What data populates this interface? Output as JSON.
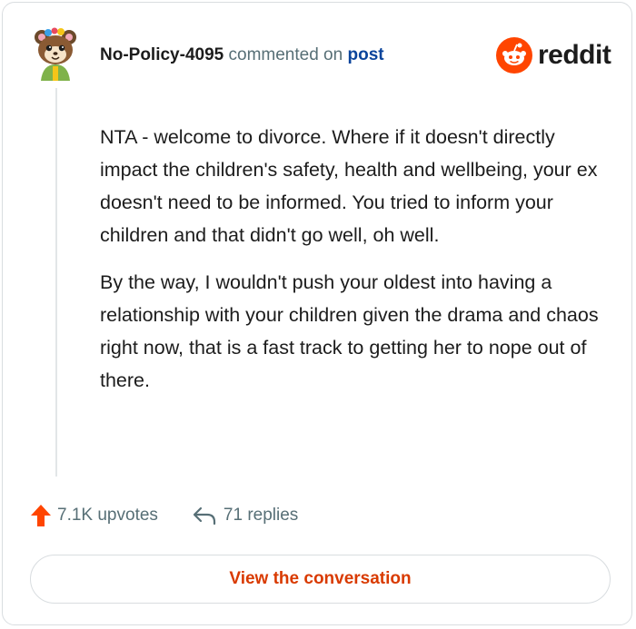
{
  "comment": {
    "author": "No-Policy-4095",
    "action_text": "commented on",
    "target_link": "post",
    "paragraphs": [
      "NTA - welcome to divorce. Where if it doesn't directly impact the children's safety, health and wellbeing, your ex doesn't need to be informed. You tried to inform your children and that didn't go well, oh well.",
      "By the way, I wouldn't push your oldest into having a relationship with your children given the drama and chaos right now, that is a fast track to getting her to nope out of there."
    ]
  },
  "brand": {
    "name": "reddit",
    "logo_icon": "reddit-snoo-icon",
    "color": "#ff4500"
  },
  "stats": {
    "upvotes": "7.1K upvotes",
    "upvote_icon": "upvote-arrow-icon",
    "upvote_color": "#ff4500",
    "replies": "71 replies",
    "reply_icon": "reply-arrow-icon"
  },
  "cta": {
    "label": "View the conversation",
    "color": "#d93a00"
  }
}
